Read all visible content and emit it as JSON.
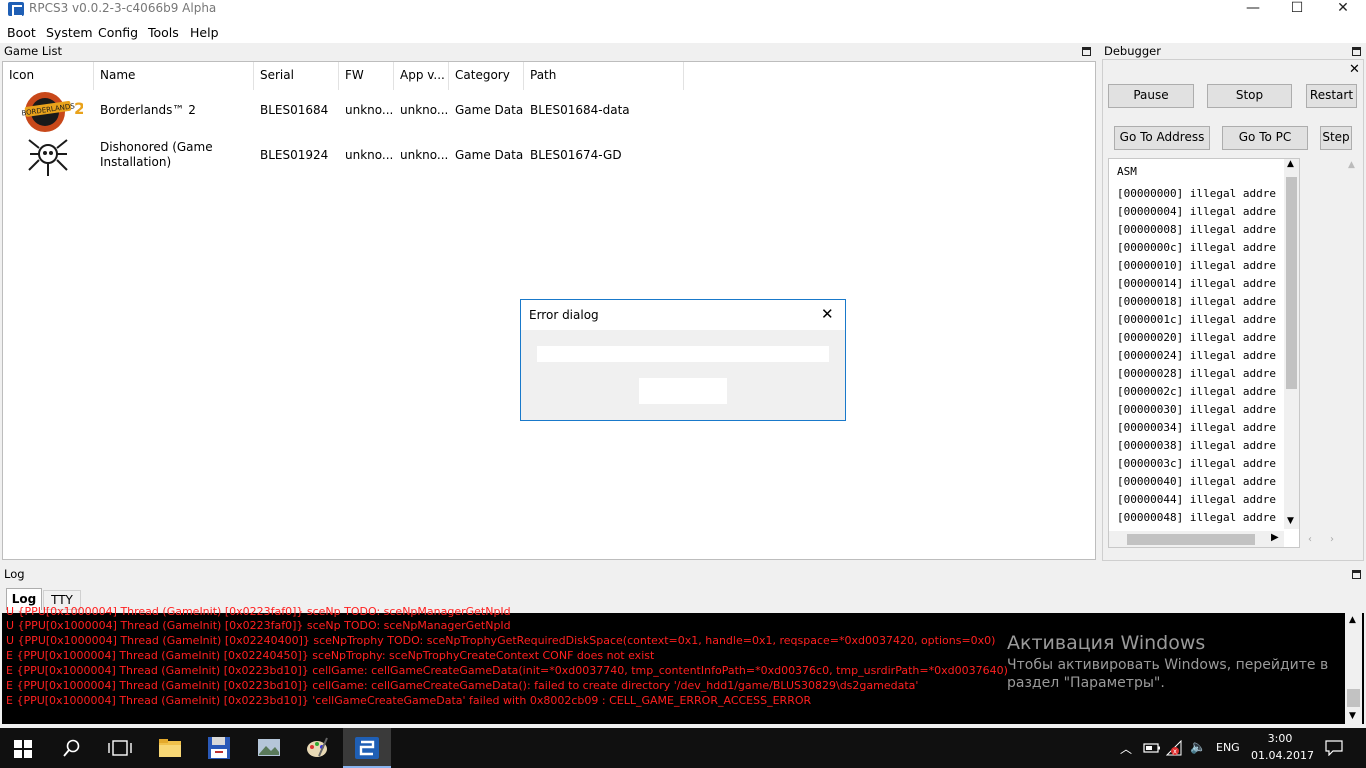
{
  "window": {
    "title": "RPCS3 v0.0.2-3-c4066b9 Alpha",
    "buttons": {
      "minimize": "—",
      "maximize": "☐",
      "close": "✕"
    }
  },
  "menu": [
    "Boot",
    "System",
    "Config",
    "Tools",
    "Help"
  ],
  "game_list": {
    "title": "Game List",
    "columns": [
      "Icon",
      "Name",
      "Serial",
      "FW",
      "App v...",
      "Category",
      "Path"
    ],
    "rows": [
      {
        "name": "Borderlands™ 2",
        "serial": "BLES01684",
        "fw": "unkno...",
        "app_ver": "unkno...",
        "category": "Game Data",
        "path": "BLES01684-data"
      },
      {
        "name": "Dishonored (Game Installation)",
        "serial": "BLES01924",
        "fw": "unkno...",
        "app_ver": "unkno...",
        "category": "Game Data",
        "path": "BLES01674-GD"
      }
    ]
  },
  "debugger": {
    "title": "Debugger",
    "buttons": {
      "pause": "Pause",
      "stop": "Stop",
      "restart": "Restart",
      "go_to_address": "Go To Address",
      "go_to_pc": "Go To PC",
      "step": "Step"
    },
    "asm_header": "ASM",
    "asm_lines": [
      "[00000000] illegal addre",
      "[00000004] illegal addre",
      "[00000008] illegal addre",
      "[0000000c] illegal addre",
      "[00000010] illegal addre",
      "[00000014] illegal addre",
      "[00000018] illegal addre",
      "[0000001c] illegal addre",
      "[00000020] illegal addre",
      "[00000024] illegal addre",
      "[00000028] illegal addre",
      "[0000002c] illegal addre",
      "[00000030] illegal addre",
      "[00000034] illegal addre",
      "[00000038] illegal addre",
      "[0000003c] illegal addre",
      "[00000040] illegal addre",
      "[00000044] illegal addre",
      "[00000048] illegal addre"
    ]
  },
  "log": {
    "title": "Log",
    "tabs": [
      "Log",
      "TTY"
    ],
    "partial_line": "U {PPU[0x1000004] Thread (GameInit) [0x0223faf0]} sceNp TODO: sceNpManagerGetNpId",
    "lines": [
      "U {PPU[0x1000004] Thread (GameInit) [0x0223faf0]} sceNp TODO: sceNpManagerGetNpId",
      "U {PPU[0x1000004] Thread (GameInit) [0x02240400]} sceNpTrophy TODO: sceNpTrophyGetRequiredDiskSpace(context=0x1, handle=0x1, reqspace=*0xd0037420, options=0x0)",
      "E {PPU[0x1000004] Thread (GameInit) [0x02240450]} sceNpTrophy: sceNpTrophyCreateContext CONF does not exist",
      "E {PPU[0x1000004] Thread (GameInit) [0x0223bd10]} cellGame: cellGameCreateGameData(init=*0xd0037740, tmp_contentInfoPath=*0xd00376c0, tmp_usrdirPath=*0xd0037640)",
      "E {PPU[0x1000004] Thread (GameInit) [0x0223bd10]} cellGame: cellGameCreateGameData(): failed to create directory '/dev_hdd1/game/BLUS30829\\ds2gamedata'",
      "E {PPU[0x1000004] Thread (GameInit) [0x0223bd10]} 'cellGameCreateGameData' failed with 0x8002cb09 : CELL_GAME_ERROR_ACCESS_ERROR"
    ],
    "line_color": "#ff2020"
  },
  "activation": {
    "title": "Активация Windows",
    "line1": "Чтобы активировать Windows, перейдите в",
    "line2": "раздел \"Параметры\"."
  },
  "dialog": {
    "title": "Error dialog",
    "close": "✕"
  },
  "taskbar": {
    "lang": "ENG",
    "time": "3:00",
    "date": "01.04.2017"
  },
  "accent": "#1979ca"
}
